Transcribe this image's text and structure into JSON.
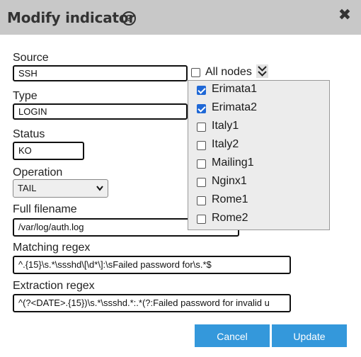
{
  "dialog": {
    "title": "Modify indicator",
    "help_glyph": "?",
    "close_glyph": "✖"
  },
  "fields": {
    "source": {
      "label": "Source",
      "value": "SSH"
    },
    "type": {
      "label": "Type",
      "value": "LOGIN"
    },
    "status": {
      "label": "Status",
      "value": "KO"
    },
    "operation": {
      "label": "Operation",
      "value": "TAIL"
    },
    "filename": {
      "label": "Full filename",
      "value": "/var/log/auth.log"
    },
    "matching": {
      "label": "Matching regex",
      "value": "^.{15}\\s.*\\ssshd\\[\\d*\\]:\\sFailed password for\\s.*$"
    },
    "extraction": {
      "label": "Extraction regex",
      "value": "^(?<DATE>.{15})\\s.*\\ssshd.*:.*(?:Failed password for invalid u"
    }
  },
  "nodes": {
    "all_label": "All nodes",
    "all_checked": false,
    "items": [
      {
        "label": "Erimata1",
        "checked": true
      },
      {
        "label": "Erimata2",
        "checked": true
      },
      {
        "label": "Italy1",
        "checked": false
      },
      {
        "label": "Italy2",
        "checked": false
      },
      {
        "label": "Mailing1",
        "checked": false
      },
      {
        "label": "Nginx1",
        "checked": false
      },
      {
        "label": "Rome1",
        "checked": false
      },
      {
        "label": "Rome2",
        "checked": false
      }
    ]
  },
  "buttons": {
    "cancel": "Cancel",
    "update": "Update"
  },
  "colors": {
    "titlebar": "#c8c8c8",
    "button": "#3498db",
    "checkbox_checked": "#1f68d6"
  }
}
